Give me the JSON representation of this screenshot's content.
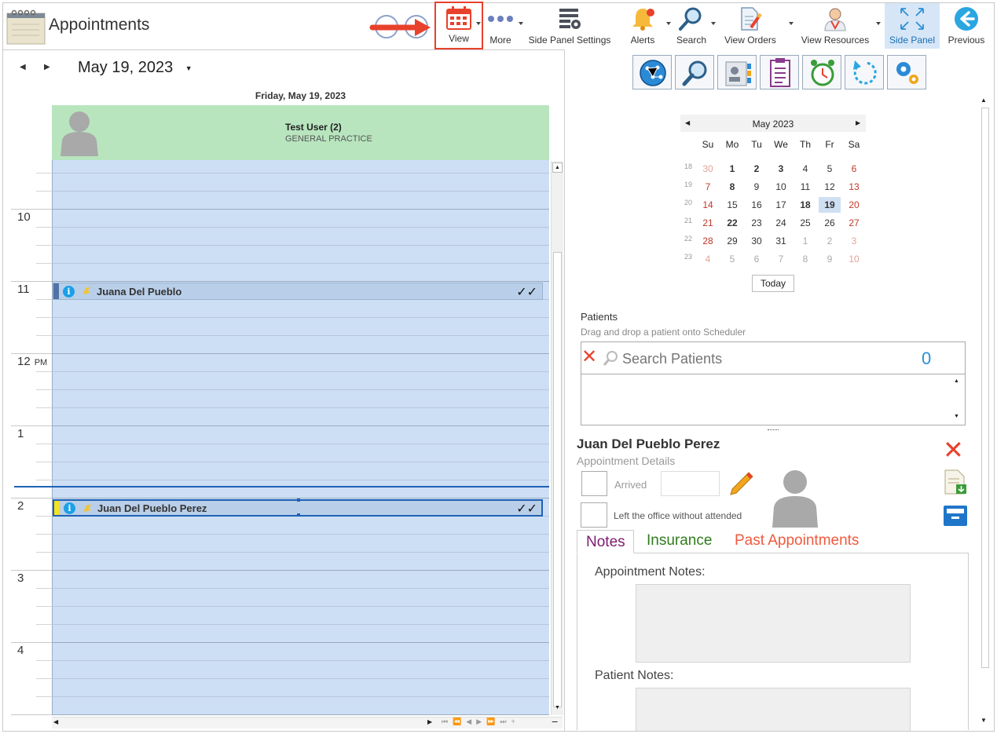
{
  "app": {
    "title": "Appointments"
  },
  "toolbar": {
    "view": "View",
    "more": "More",
    "side_panel_settings": "Side Panel Settings",
    "alerts": "Alerts",
    "search": "Search",
    "view_orders": "View Orders",
    "view_resources": "View Resources",
    "side_panel": "Side Panel",
    "previous": "Previous"
  },
  "scheduler": {
    "date": "May 19, 2023",
    "day_header": "Friday, May 19, 2023",
    "resource": {
      "name": "Test User (2)",
      "department": "GENERAL PRACTICE"
    },
    "hours": [
      {
        "label": "10",
        "ampm": ""
      },
      {
        "label": "11",
        "ampm": ""
      },
      {
        "label": "12",
        "ampm": "PM"
      },
      {
        "label": "1",
        "ampm": ""
      },
      {
        "label": "2",
        "ampm": ""
      },
      {
        "label": "3",
        "ampm": ""
      },
      {
        "label": "4",
        "ampm": ""
      }
    ],
    "appointments": [
      {
        "name": "Juana Del Pueblo",
        "status": "✓✓"
      },
      {
        "name": "Juan Del Pueblo Perez",
        "status": "✓✓"
      }
    ]
  },
  "calendar": {
    "month": "May 2023",
    "weekdays": [
      "Su",
      "Mo",
      "Tu",
      "We",
      "Th",
      "Fr",
      "Sa"
    ],
    "weeks": [
      {
        "wk": "18",
        "days": [
          "30",
          "1",
          "2",
          "3",
          "4",
          "5",
          "6"
        ]
      },
      {
        "wk": "19",
        "days": [
          "7",
          "8",
          "9",
          "10",
          "11",
          "12",
          "13"
        ]
      },
      {
        "wk": "20",
        "days": [
          "14",
          "15",
          "16",
          "17",
          "18",
          "19",
          "20"
        ]
      },
      {
        "wk": "21",
        "days": [
          "21",
          "22",
          "23",
          "24",
          "25",
          "26",
          "27"
        ]
      },
      {
        "wk": "22",
        "days": [
          "28",
          "29",
          "30",
          "31",
          "1",
          "2",
          "3"
        ]
      },
      {
        "wk": "23",
        "days": [
          "4",
          "5",
          "6",
          "7",
          "8",
          "9",
          "10"
        ]
      }
    ],
    "today_label": "Today"
  },
  "patients": {
    "title": "Patients",
    "hint": "Drag and drop a patient onto Scheduler",
    "search_placeholder": "Search Patients",
    "count": "0"
  },
  "details": {
    "patient_name": "Juan Del Pueblo Perez",
    "subtitle": "Appointment Details",
    "arrived_label": "Arrived",
    "left_label": "Left the office without attended",
    "tabs": [
      "Notes",
      "Insurance",
      "Past Appointments"
    ],
    "appointment_notes_label": "Appointment Notes:",
    "patient_notes_label": "Patient Notes:"
  },
  "colors": {
    "accent_red": "#e8412c",
    "notes_tab": "#7b1a6e",
    "insurance_tab": "#2f7d1c",
    "past_tab": "#ef5a3e",
    "resource_header": "#b8e5be",
    "scheduler_bg": "#cddff5"
  }
}
